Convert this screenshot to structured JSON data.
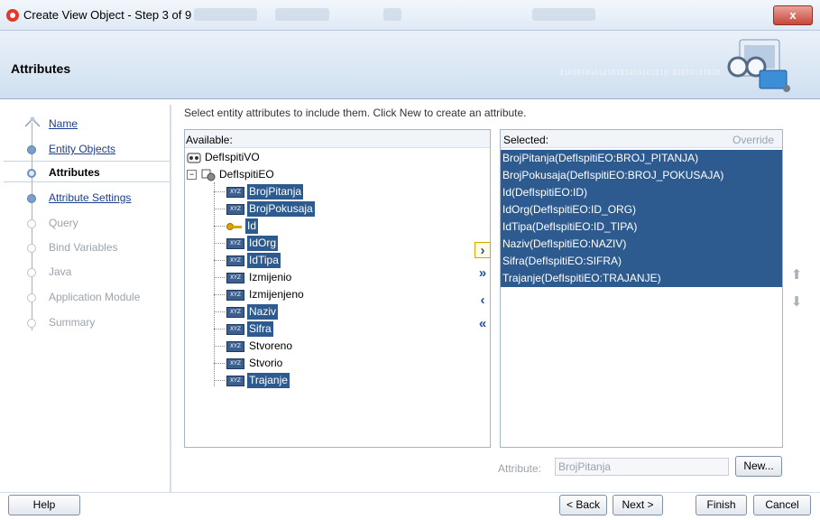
{
  "window": {
    "title": "Create View Object - Step 3 of 9",
    "close_label": "x"
  },
  "header": {
    "title": "Attributes",
    "binary_deco": "0101010101010101010101010 01010101010"
  },
  "nav": {
    "items": [
      {
        "label": "Name",
        "state": "done"
      },
      {
        "label": "Entity Objects",
        "state": "done"
      },
      {
        "label": "Attributes",
        "state": "current"
      },
      {
        "label": "Attribute Settings",
        "state": "done"
      },
      {
        "label": "Query",
        "state": "future"
      },
      {
        "label": "Bind Variables",
        "state": "future"
      },
      {
        "label": "Java",
        "state": "future"
      },
      {
        "label": "Application Module",
        "state": "future"
      },
      {
        "label": "Summary",
        "state": "future"
      }
    ]
  },
  "main": {
    "instruction": "Select entity attributes to include them.  Click New to create an attribute.",
    "available_label": "Available:",
    "selected_label": "Selected:",
    "override_label": "Override",
    "tree": {
      "root": "DefIspitiVO",
      "entity": "DefIspitiEO",
      "attributes": [
        {
          "name": "BrojPitanja",
          "selected": true,
          "key": false
        },
        {
          "name": "BrojPokusaja",
          "selected": true,
          "key": false
        },
        {
          "name": "Id",
          "selected": true,
          "key": true
        },
        {
          "name": "IdOrg",
          "selected": true,
          "key": false
        },
        {
          "name": "IdTipa",
          "selected": true,
          "key": false
        },
        {
          "name": "Izmijenio",
          "selected": false,
          "key": false
        },
        {
          "name": "Izmijenjeno",
          "selected": false,
          "key": false
        },
        {
          "name": "Naziv",
          "selected": true,
          "key": false
        },
        {
          "name": "Sifra",
          "selected": true,
          "key": false
        },
        {
          "name": "Stvoreno",
          "selected": false,
          "key": false
        },
        {
          "name": "Stvorio",
          "selected": false,
          "key": false
        },
        {
          "name": "Trajanje",
          "selected": true,
          "key": false
        }
      ]
    },
    "selected": [
      "BrojPitanja(DefIspitiEO:BROJ_PITANJA)",
      "BrojPokusaja(DefIspitiEO:BROJ_POKUSAJA)",
      "Id(DefIspitiEO:ID)",
      "IdOrg(DefIspitiEO:ID_ORG)",
      "IdTipa(DefIspitiEO:ID_TIPA)",
      "Naziv(DefIspitiEO:NAZIV)",
      "Sifra(DefIspitiEO:SIFRA)",
      "Trajanje(DefIspitiEO:TRAJANJE)"
    ],
    "shuttle": {
      "add": "›",
      "add_all": "»",
      "remove": "‹",
      "remove_all": "«"
    },
    "updown": {
      "up": "⬆",
      "down": "⬇"
    },
    "attribute_label": "Attribute:",
    "attribute_value": "BrojPitanja",
    "new_button": "New..."
  },
  "footer": {
    "help": "Help",
    "back": "< Back",
    "next": "Next >",
    "finish": "Finish",
    "cancel": "Cancel"
  },
  "icons": {
    "attr_icon_text": "XYZ"
  }
}
